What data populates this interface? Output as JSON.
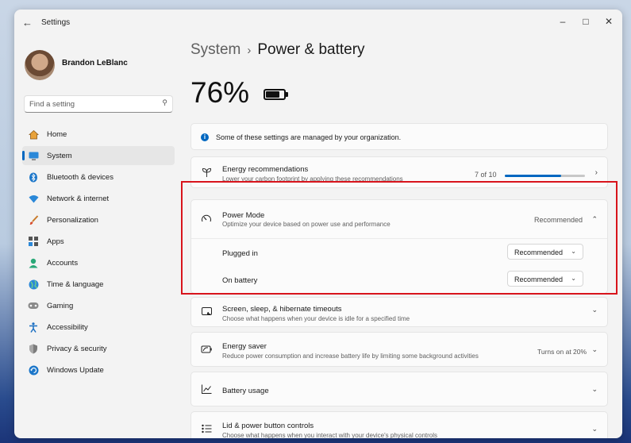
{
  "window": {
    "title": "Settings",
    "back_icon": "back-arrow-icon",
    "controls": [
      "minimize-icon",
      "maximize-icon",
      "close-icon"
    ]
  },
  "user": {
    "name": "Brandon LeBlanc"
  },
  "search": {
    "placeholder": "Find a setting",
    "icon": "search-icon"
  },
  "nav": {
    "items": [
      {
        "label": "Home",
        "icon": "home-icon"
      },
      {
        "label": "System",
        "icon": "system-icon",
        "active": true
      },
      {
        "label": "Bluetooth & devices",
        "icon": "bluetooth-icon"
      },
      {
        "label": "Network & internet",
        "icon": "wifi-icon"
      },
      {
        "label": "Personalization",
        "icon": "brush-icon"
      },
      {
        "label": "Apps",
        "icon": "apps-icon"
      },
      {
        "label": "Accounts",
        "icon": "account-icon"
      },
      {
        "label": "Time & language",
        "icon": "globe-icon"
      },
      {
        "label": "Gaming",
        "icon": "gamepad-icon"
      },
      {
        "label": "Accessibility",
        "icon": "accessibility-icon"
      },
      {
        "label": "Privacy & security",
        "icon": "shield-icon"
      },
      {
        "label": "Windows Update",
        "icon": "update-icon"
      }
    ]
  },
  "breadcrumb": {
    "parent": "System",
    "separator": "›",
    "current": "Power & battery"
  },
  "battery": {
    "percent_text": "76%",
    "level": 0.76
  },
  "info_banner": {
    "text": "Some of these settings are managed by your organization."
  },
  "energy_recommendations": {
    "title": "Energy recommendations",
    "desc": "Lower your carbon footprint by applying these recommendations",
    "count": "7 of 10",
    "progress": 0.7
  },
  "power_mode": {
    "title": "Power Mode",
    "desc": "Optimize your device based on power use and performance",
    "value": "Recommended",
    "plugged_in": {
      "label": "Plugged in",
      "value": "Recommended"
    },
    "on_battery": {
      "label": "On battery",
      "value": "Recommended"
    }
  },
  "screen_sleep": {
    "title": "Screen, sleep, & hibernate timeouts",
    "desc": "Choose what happens when your device is idle for a specified time"
  },
  "energy_saver": {
    "title": "Energy saver",
    "desc": "Reduce power consumption and increase battery life by limiting some background activities",
    "status": "Turns on at 20%"
  },
  "battery_usage": {
    "title": "Battery usage"
  },
  "lid_power": {
    "title": "Lid & power button controls",
    "desc": "Choose what happens when you interact with your device's physical controls"
  },
  "colors": {
    "accent": "#0067c0",
    "highlight": "#d8141c"
  }
}
